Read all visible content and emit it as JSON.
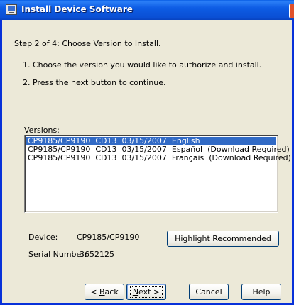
{
  "window": {
    "title": "Install Device Software"
  },
  "step": {
    "text": "Step 2 of 4:  Choose Version to Install."
  },
  "instructions": [
    "1.  Choose the version you would like to authorize and install.",
    "2.  Press the next button to continue."
  ],
  "versions": {
    "label": "Versions:",
    "items": [
      {
        "model": "CP9185/CP9190",
        "cd": "CD13",
        "date": "03/15/2007",
        "language": "English",
        "note": "",
        "selected": true
      },
      {
        "model": "CP9185/CP9190",
        "cd": "CD13",
        "date": "03/15/2007",
        "language": "Español",
        "note": "(Download Required)",
        "selected": false
      },
      {
        "model": "CP9185/CP9190",
        "cd": "CD13",
        "date": "03/15/2007",
        "language": "Français",
        "note": "(Download Required)",
        "selected": false
      }
    ]
  },
  "device": {
    "label": "Device:",
    "value": "CP9185/CP9190"
  },
  "serial": {
    "label": "Serial Number:",
    "value": "3652125"
  },
  "buttons": {
    "highlight": "Highlight Recommended",
    "back": {
      "prefix": "< ",
      "mnemonic": "B",
      "rest": "ack"
    },
    "next": {
      "mnemonic": "N",
      "rest": "ext >"
    },
    "cancel": "Cancel",
    "help": "Help"
  },
  "colors": {
    "titlebar": "#0a4fd4",
    "selection": "#316ac5",
    "dialog": "#ece9d8"
  }
}
